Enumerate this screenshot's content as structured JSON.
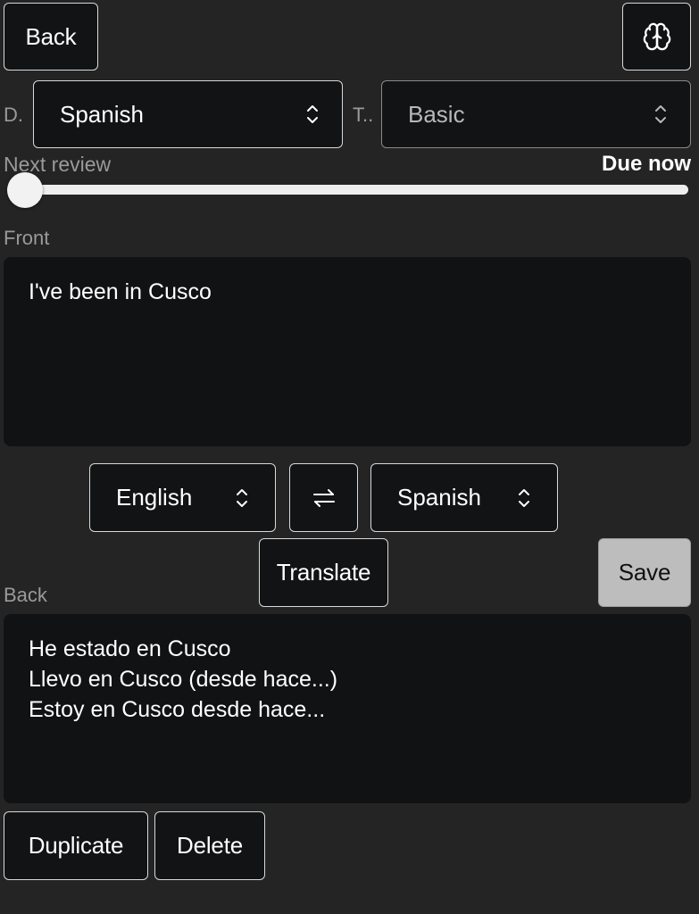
{
  "header": {
    "back_label": "Back",
    "brain_icon": "brain-icon"
  },
  "filters": {
    "deck_label": "D.",
    "deck_value": "Spanish",
    "type_label": "T..",
    "type_value": "Basic"
  },
  "review": {
    "label": "Next review",
    "value_label": "Due now",
    "slider_fraction": 0.0
  },
  "front": {
    "label": "Front",
    "text": "I've been in Cusco"
  },
  "translate": {
    "source_lang": "English",
    "swap_icon": "swap-arrows-icon",
    "target_lang": "Spanish",
    "translate_label": "Translate",
    "save_label": "Save"
  },
  "back": {
    "label": "Back",
    "text": "He estado en Cusco\nLlevo en Cusco (desde hace...)\nEstoy en Cusco desde hace..."
  },
  "actions": {
    "duplicate_label": "Duplicate",
    "delete_label": "Delete"
  }
}
